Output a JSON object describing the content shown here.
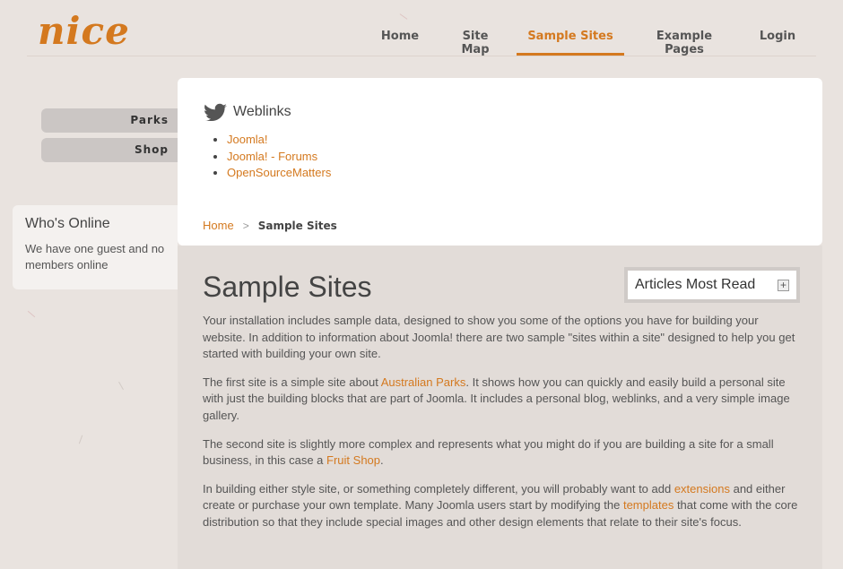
{
  "logo": "nice",
  "nav": [
    {
      "label": "Home",
      "active": false
    },
    {
      "label": "Site Map",
      "active": false
    },
    {
      "label": "Sample Sites",
      "active": true
    },
    {
      "label": "Example Pages",
      "active": false
    },
    {
      "label": "Login",
      "active": false
    }
  ],
  "sidebar": {
    "menu": [
      {
        "label": "Parks"
      },
      {
        "label": "Shop"
      }
    ],
    "whos_online": {
      "title": "Who's Online",
      "text": "We have one guest and no members online"
    }
  },
  "weblinks": {
    "icon": "twitter-bird-icon",
    "title": "Weblinks",
    "links": [
      "Joomla!",
      "Joomla! - Forums",
      "OpenSourceMatters"
    ]
  },
  "breadcrumb": {
    "home": "Home",
    "separator": ">",
    "current": "Sample Sites"
  },
  "main": {
    "title": "Sample Sites",
    "most_read": {
      "label": "Articles Most Read",
      "icon": "plus-icon"
    },
    "para1": "Your installation includes sample data, designed to show you some of the options you have for building your website. In addition to information about Joomla! there are two sample \"sites within a site\" designed to help you get started with building your own site.",
    "para2_a": "The first site is a simple site about ",
    "para2_link": "Australian Parks",
    "para2_b": ". It shows how you can quickly and easily build a personal site with just the building blocks that are part of Joomla. It includes a personal blog, weblinks, and a very simple image gallery.",
    "para3_a": "The second site is slightly more complex and represents what you might do if you are building a site for a small business, in this case a ",
    "para3_link": "Fruit Shop",
    "para3_b": ".",
    "para4_a": "In building either style site, or something completely different, you will probably want to add ",
    "para4_link1": "extensions",
    "para4_b": " and either create or purchase your own template. Many Joomla users start by modifying the ",
    "para4_link2": "templates",
    "para4_c": " that come with the core distribution so that they include special images and other design elements that relate to their site's focus."
  },
  "colors": {
    "accent": "#d4791f",
    "background": "#e9e3df",
    "panel": "#ffffff"
  }
}
